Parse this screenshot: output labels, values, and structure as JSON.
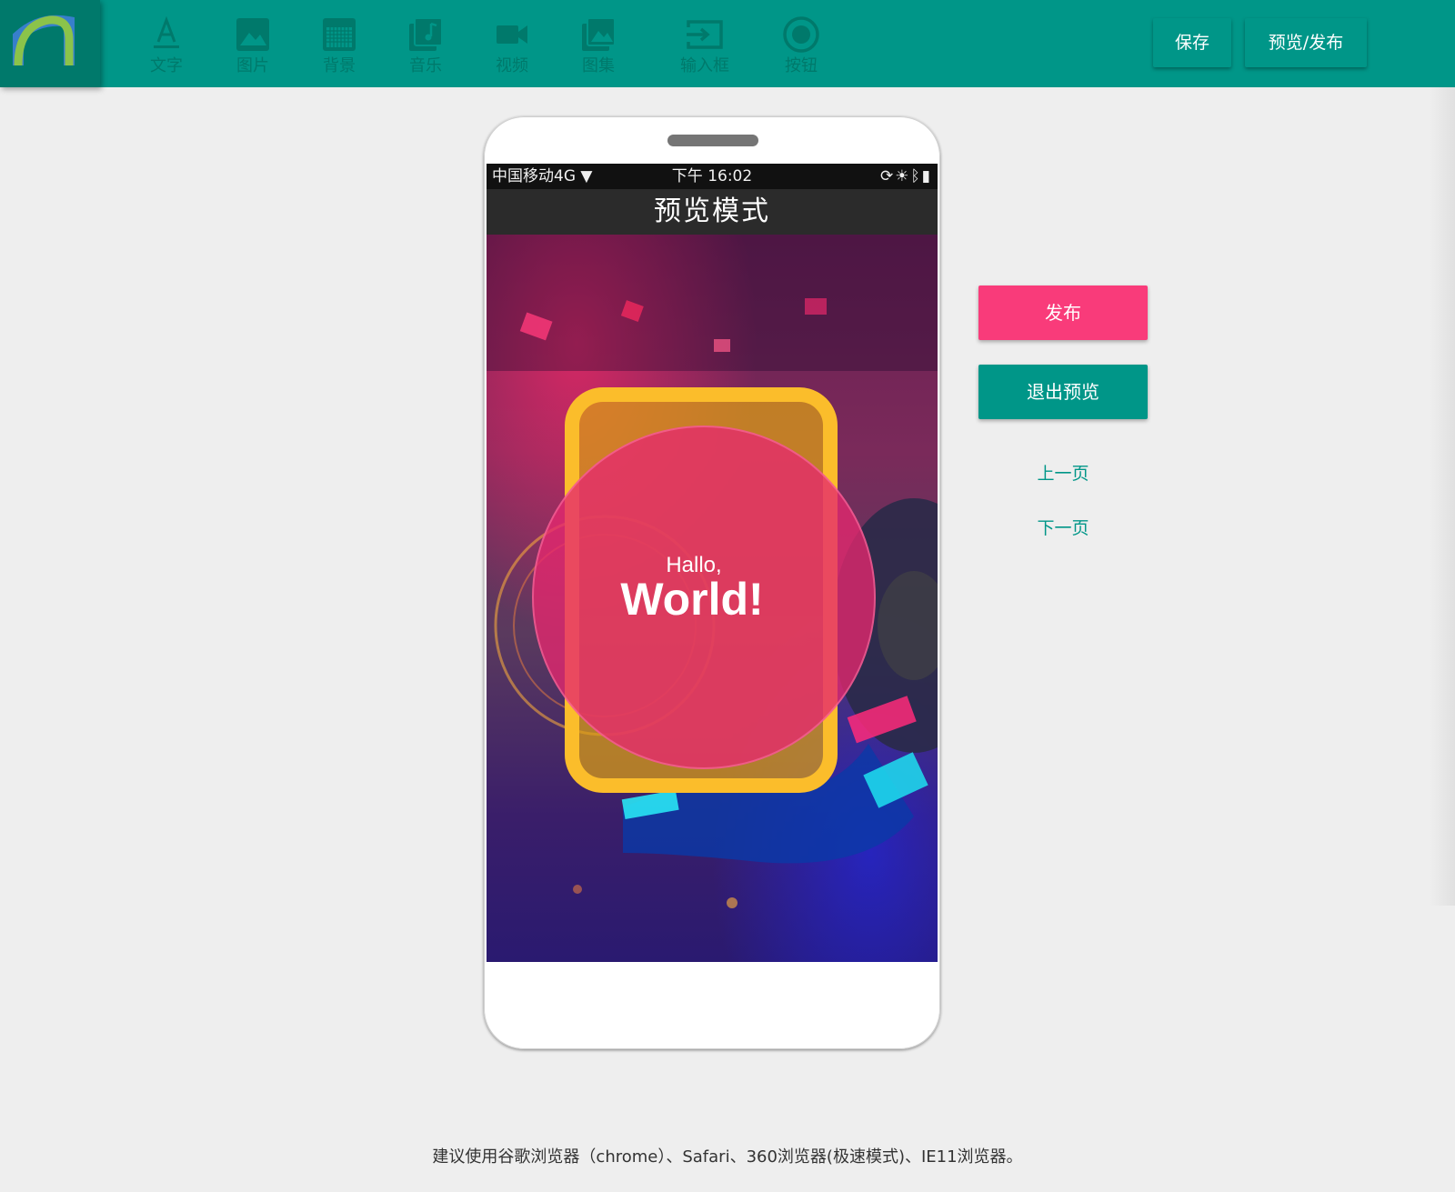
{
  "toolbar": {
    "tools": [
      {
        "label": "文字",
        "icon": "text-icon"
      },
      {
        "label": "图片",
        "icon": "image-icon"
      },
      {
        "label": "背景",
        "icon": "background-icon"
      },
      {
        "label": "音乐",
        "icon": "music-icon"
      },
      {
        "label": "视频",
        "icon": "video-icon"
      },
      {
        "label": "图集",
        "icon": "gallery-icon"
      },
      {
        "label": "输入框",
        "icon": "input-box-icon"
      },
      {
        "label": "按钮",
        "icon": "button-icon"
      }
    ],
    "save_label": "保存",
    "preview_publish_label": "预览/发布"
  },
  "phone": {
    "status": {
      "carrier": "中国移动4G",
      "time": "下午 16:02",
      "icons": [
        "sync-icon",
        "brightness-icon",
        "bluetooth-icon",
        "battery-icon"
      ]
    },
    "title": "预览模式",
    "content": {
      "greeting": "Hallo,",
      "headline": "World!"
    }
  },
  "actions": {
    "publish_label": "发布",
    "exit_preview_label": "退出预览",
    "prev_page_label": "上一页",
    "next_page_label": "下一页"
  },
  "footer": {
    "note": "建议使用谷歌浏览器（chrome）、Safari、360浏览器(极速模式)、IE11浏览器。"
  },
  "colors": {
    "primary": "#009688",
    "primary_dark": "#00796b",
    "accent_pink": "#f93b7a",
    "card_yellow": "#fbbd2b"
  }
}
